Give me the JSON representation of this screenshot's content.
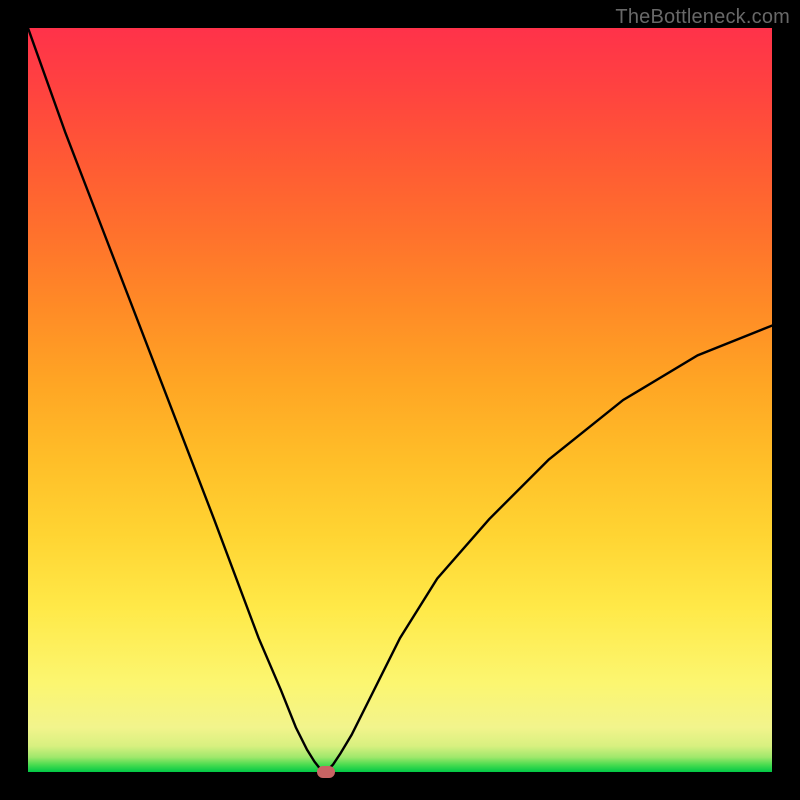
{
  "watermark": "TheBottleneck.com",
  "colors": {
    "frame": "#000000",
    "watermark": "#686868",
    "curve": "#000000",
    "dot": "#c86464"
  },
  "chart_data": {
    "type": "line",
    "title": "",
    "xlabel": "",
    "ylabel": "",
    "xlim": [
      0,
      100
    ],
    "ylim": [
      0,
      100
    ],
    "series": [
      {
        "name": "bottleneck-curve",
        "x": [
          0,
          5,
          10,
          15,
          20,
          25,
          28,
          31,
          34,
          36,
          37.5,
          38.5,
          39.2,
          39.8,
          40,
          40.2,
          41,
          42,
          43.5,
          46,
          50,
          55,
          62,
          70,
          80,
          90,
          100
        ],
        "y": [
          100,
          86,
          73,
          60,
          47,
          34,
          26,
          18,
          11,
          6,
          3,
          1.4,
          0.5,
          0.1,
          0,
          0.2,
          1,
          2.5,
          5,
          10,
          18,
          26,
          34,
          42,
          50,
          56,
          60
        ]
      }
    ],
    "annotations": [
      {
        "name": "min-point",
        "x": 40,
        "y": 0
      }
    ]
  }
}
